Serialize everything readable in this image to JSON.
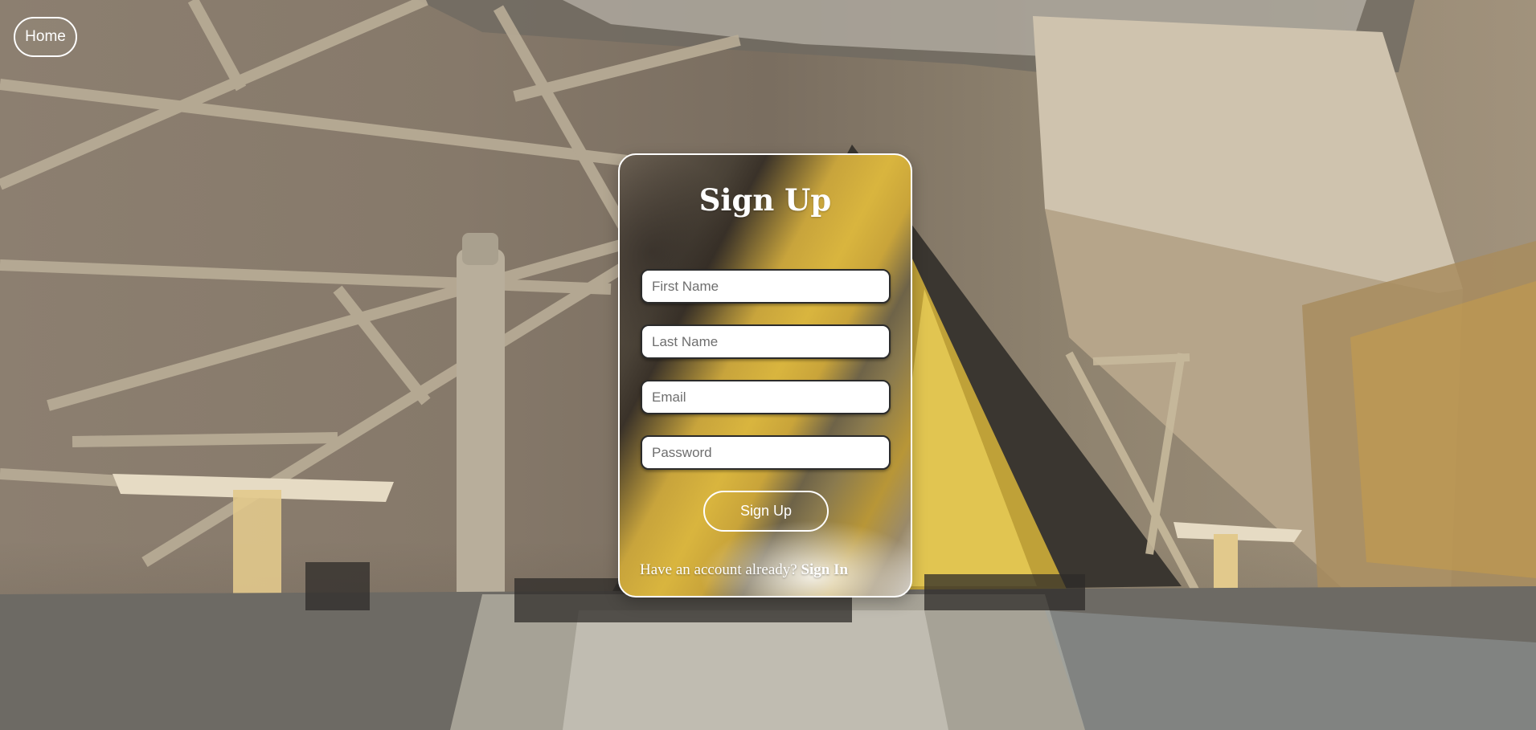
{
  "nav": {
    "home_label": "Home"
  },
  "form": {
    "title": "Sign Up",
    "first_name_placeholder": "First Name",
    "last_name_placeholder": "Last Name",
    "email_placeholder": "Email",
    "password_placeholder": "Password",
    "submit_label": "Sign Up",
    "footer_text": "Have an account already?",
    "signin_link": "Sign In"
  },
  "colors": {
    "accent_gold": "#d9b53e",
    "text_white": "#ffffff"
  }
}
